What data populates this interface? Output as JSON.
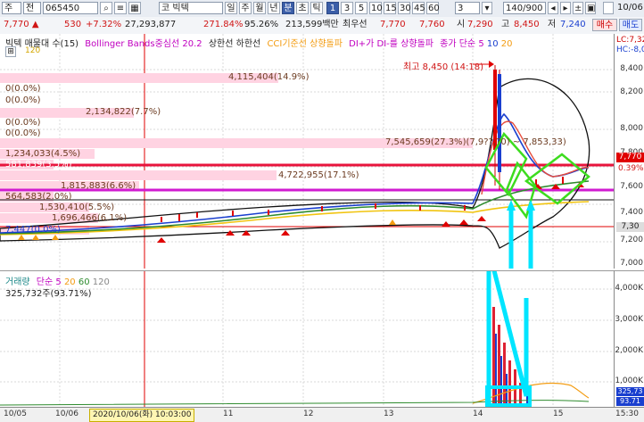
{
  "toolbar": {
    "row1": {
      "type_code": "주",
      "prev_label": "전",
      "code": "065450",
      "market": "코",
      "name": "빅텍",
      "periods": [
        "일",
        "주",
        "월",
        "년",
        "분",
        "초",
        "틱"
      ],
      "selected_period": "분",
      "intervals": [
        "1",
        "3",
        "5",
        "10",
        "15",
        "30",
        "45",
        "60"
      ],
      "interval_value": "3",
      "count": "140/900",
      "date": "10/06"
    },
    "row2": {
      "price": "7,770",
      "change": "530",
      "change_pct": "+7.32%",
      "volume": "27,293,877",
      "vol_ratio": "271.84%",
      "rate": "95.26%",
      "amount": "213,599백만",
      "best_label": "최우선",
      "ask": "7,770",
      "bid": "7,760",
      "open_label": "시",
      "open": "7,290",
      "high_label": "고",
      "high": "8,450",
      "low_label": "저",
      "low": "7,240",
      "buy_label": "매수",
      "sell_label": "매도"
    }
  },
  "legend": {
    "title": "빅텍 매물대 수(15)",
    "sub": "120",
    "boll": "Bollinger Bands중심선 20.2",
    "upper": "상한선",
    "lower": "하한선",
    "cci": "CCI기준선 상향돌파",
    "dmi": "DI+가 DI-를 상향돌파",
    "ma": "종가 단순 5",
    "ma10": "10",
    "ma20": "20",
    "lc": "LC:7,32",
    "hc": "HC:-8,0"
  },
  "volume_profile": [
    {
      "label": "4,115,404(14.9%)"
    },
    {
      "label": "0(0.0%)"
    },
    {
      "label": "0(0.0%)"
    },
    {
      "label": "2,134,822(7.7%)"
    },
    {
      "label": "0(0.0%)"
    },
    {
      "label": "0(0.0%)"
    },
    {
      "label": "7,545,659(27.3%)(7,9??,?0) ~ 7,853,33)"
    },
    {
      "label": "1,234,033(4.5%)"
    },
    {
      "label": "581,839(3.5%)"
    },
    {
      "label": "4,722,955(17.1%)"
    },
    {
      "label": "1,815,883(6.6%)"
    },
    {
      "label": "564,583(2.0%)"
    },
    {
      "label": "1,530,410(5.5%)"
    },
    {
      "label": "1,696,466(6.1%)"
    },
    {
      "label": "7,447(0.0%)"
    }
  ],
  "annotation_high": "최고 8,450 (14:18)",
  "price_axis": {
    "ticks": [
      "8,400",
      "8,200",
      "8,000",
      "7,800",
      "7,600",
      "7,400",
      "7,200",
      "7,000"
    ],
    "current": "7,770",
    "current_pct": "0.39%",
    "level2": "7,30"
  },
  "volume_panel": {
    "title": "거래량",
    "ma_label": "단순 5",
    "ma20": "20",
    "ma60": "60",
    "ma120": "120",
    "value": "325,732주(93.71%)",
    "ticks": [
      "4,000K",
      "3,000K",
      "2,000K",
      "1,000K"
    ],
    "cur": "325,73",
    "cur2": "93.71"
  },
  "x_axis": {
    "labels": [
      "10/05",
      "10/06",
      "2020/10/06(화) 10:03:00",
      "11",
      "12",
      "13",
      "14",
      "15",
      "15:30"
    ]
  },
  "colors": {
    "accent": "#ff1493",
    "red": "#e00000",
    "blue": "#1a3fcf",
    "highlight_green": "#3ddc1f",
    "cyan": "#00e5ff"
  }
}
